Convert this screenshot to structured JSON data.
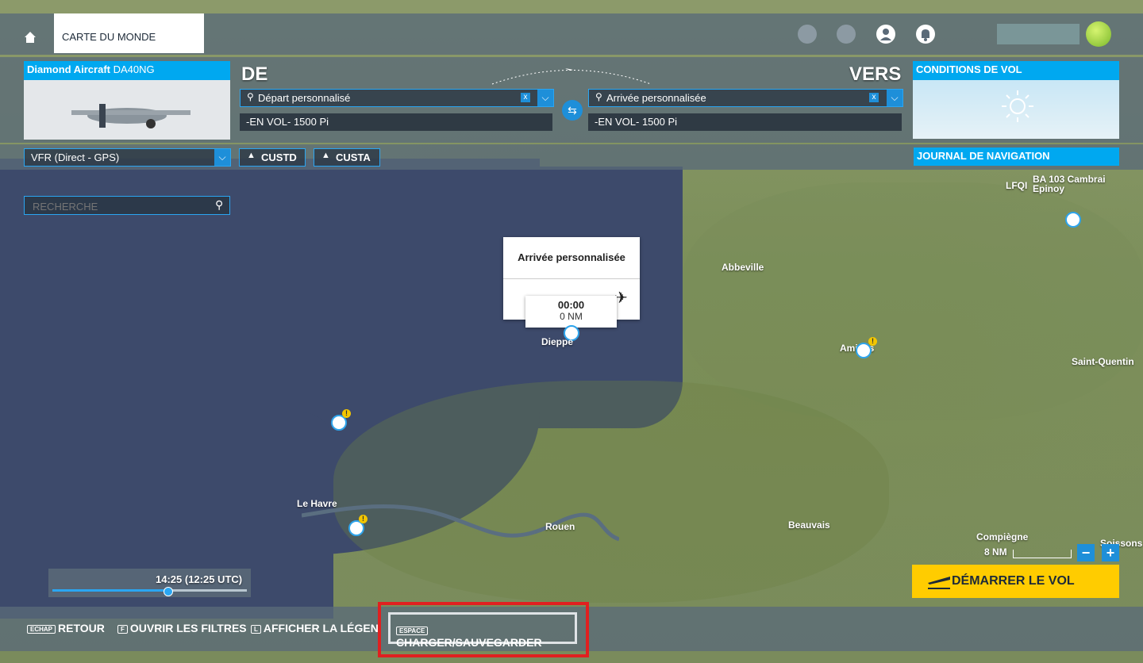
{
  "top_nav": {
    "world_map_tab": "CARTE DU MONDE"
  },
  "aircraft": {
    "brand": "Diamond Aircraft",
    "model": "DA40NG"
  },
  "route": {
    "from_label": "DE",
    "to_label": "VERS",
    "departure": "Départ personnalisé",
    "arrival": "Arrivée personnalisée",
    "departure_alt": "-EN VOL- 1500 Pi",
    "arrival_alt": "-EN VOL- 1500 Pi",
    "clear": "x"
  },
  "conditions": {
    "title": "CONDITIONS DE VOL"
  },
  "navlog": {
    "title": "JOURNAL DE NAVIGATION"
  },
  "flight_plan": {
    "type": "VFR (Direct - GPS)",
    "cust_d": "CUSTD",
    "cust_a": "CUSTA"
  },
  "search": {
    "placeholder": "RECHERCHE"
  },
  "popup": {
    "title": "Arrivée personnalisée",
    "time": "00:00",
    "distance": "0 NM"
  },
  "cities": {
    "abbeville": "Abbeville",
    "dieppe": "Dieppe",
    "amiens": "Amiens",
    "saint_quentin": "Saint-Quentin",
    "le_havre": "Le Havre",
    "rouen": "Rouen",
    "beauvais": "Beauvais",
    "compiegne": "Compiègne",
    "soissons": "Soissons",
    "lfqi": "LFQI",
    "ba103": "BA 103 Cambrai Epinoy"
  },
  "time": {
    "value": "14:25 (12:25 UTC)",
    "progress": 0.59
  },
  "scale": {
    "label": "8 NM"
  },
  "start_flight": "DÉMARRER LE VOL",
  "footer": {
    "back_key": "ECHAP",
    "back": "RETOUR",
    "filters_key": "F",
    "filters": "OUVRIR LES FILTRES",
    "legend_key": "L",
    "legend": "AFFICHER LA LÉGENDE",
    "load_key": "ESPACE",
    "load": "CHARGER/SAUVEGARDER"
  },
  "colors": {
    "accent": "#00a8f0",
    "start_button": "#ffcc00",
    "highlight": "#e02020"
  }
}
